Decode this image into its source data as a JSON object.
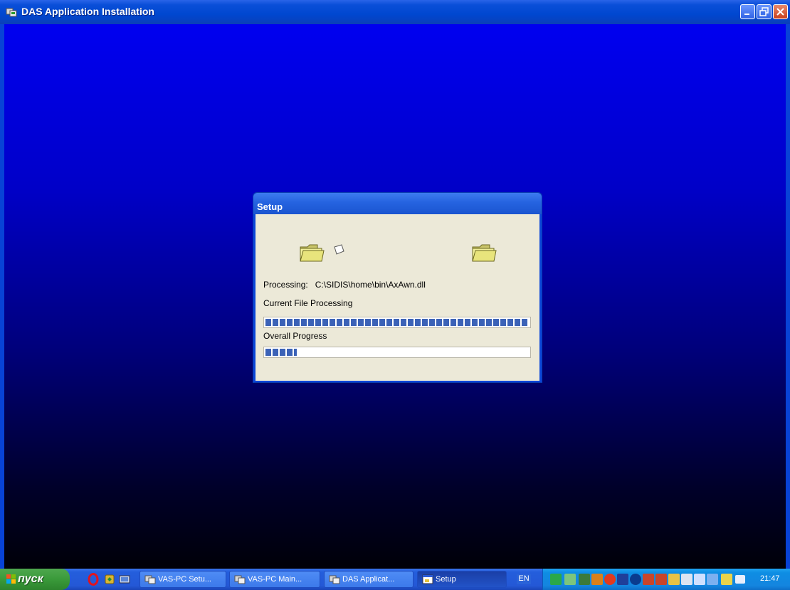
{
  "window": {
    "title": "DAS Application Installation"
  },
  "dialog": {
    "title": "Setup",
    "processing_label": "Processing:",
    "processing_path": "C:\\SIDIS\\home\\bin\\AxAwn.dll",
    "current_file_label": "Current File Processing",
    "overall_label": "Overall Progress",
    "current_progress": 1.0,
    "overall_progress": 0.12
  },
  "taskbar": {
    "start_label": "пуск",
    "buttons": [
      {
        "label": "VAS-PC Setu...",
        "icon": "installer-icon"
      },
      {
        "label": "VAS-PC Main...",
        "icon": "installer-icon"
      },
      {
        "label": "DAS Applicat...",
        "icon": "installer-icon"
      },
      {
        "label": "Setup",
        "icon": "setup-window-icon"
      }
    ],
    "language": "EN",
    "clock": "21:47"
  },
  "colors": {
    "title_bar": "#0047d0",
    "dialog_body": "#ece9d8",
    "progress_fill": "#3b62b7",
    "start_green": "#3a9a3a",
    "tray_blue": "#0e8de3"
  }
}
